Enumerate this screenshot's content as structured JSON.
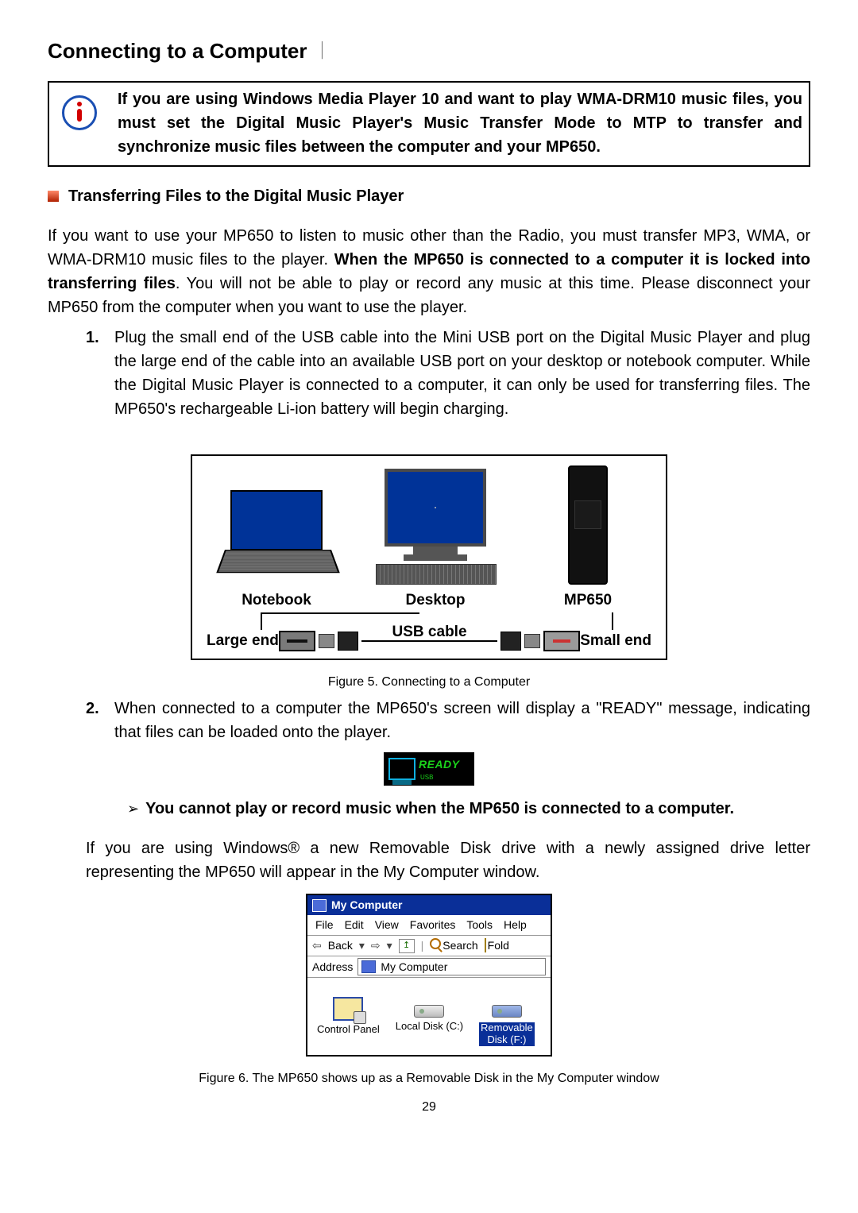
{
  "heading": "Connecting to a Computer",
  "alert": "If you are using Windows Media Player 10 and want to play WMA-DRM10 music files, you must set the Digital Music Player's Music Transfer Mode to MTP to transfer and synchronize music files between the computer and your MP650.",
  "section_title": "Transferring Files to the Digital Music Player",
  "intro_pre": "If you want to use your MP650 to listen to music other than the Radio, you must transfer MP3, WMA, or WMA-DRM10 music files to the player. ",
  "intro_bold": "When the MP650 is connected to a computer it is locked into transferring files",
  "intro_post": ". You will not be able to play or record any music at this time. Please disconnect your MP650 from the computer when you want to use the player.",
  "step1_num": "1.",
  "step1": "Plug the small end of the USB cable into the Mini USB port on the Digital Music Player and plug the large end of the cable into an available USB port on your desktop or notebook computer. While the Digital Music Player is connected to a computer, it can only be used for transferring files. The MP650's rechargeable Li-ion battery will begin charging.",
  "fig5": {
    "notebook": "Notebook",
    "desktop": "Desktop",
    "mp650": "MP650",
    "large_end": "Large end",
    "usb_cable": "USB cable",
    "small_end": "Small end",
    "caption": "Figure 5. Connecting to a Computer"
  },
  "step2_num": "2.",
  "step2": "When connected to a computer the MP650's screen will display a \"READY\" message, indicating that files can be loaded onto the player.",
  "ready_text": "READY",
  "ready_usb": "USB",
  "note": "You cannot play or record music when the MP650 is connected to a computer.",
  "windows_para": "If you are using Windows® a new Removable Disk drive with a newly assigned drive letter representing the MP650 will appear in the My Computer window.",
  "mycomputer": {
    "title": "My Computer",
    "menu": [
      "File",
      "Edit",
      "View",
      "Favorites",
      "Tools",
      "Help"
    ],
    "back": "Back",
    "search": "Search",
    "folders": "Fold",
    "address_label": "Address",
    "address_value": "My Computer",
    "control_panel": "Control Panel",
    "local_disk": "Local Disk (C:)",
    "removable_l1": "Removable",
    "removable_l2": "Disk (F:)"
  },
  "fig6_caption": "Figure 6. The MP650 shows up as a Removable Disk in the My Computer window",
  "page_number": "29"
}
